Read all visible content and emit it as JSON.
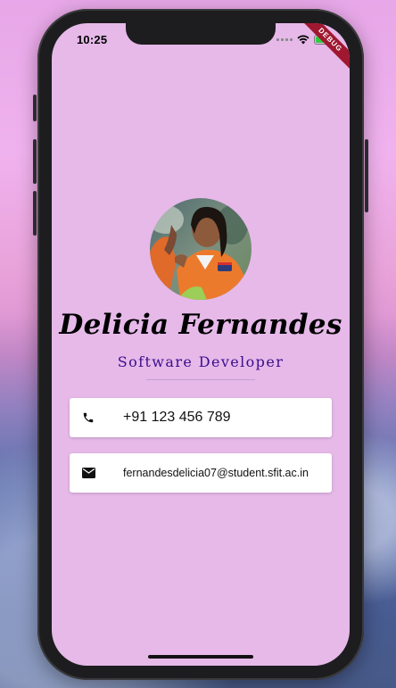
{
  "status_bar": {
    "time": "10:25",
    "debug_label": "DEBUG"
  },
  "profile": {
    "name": "Delicia Fernandes",
    "title": "Software Developer",
    "avatar_icon": "profile-photo"
  },
  "contacts": [
    {
      "icon": "phone-icon",
      "value": "+91 123 456 789"
    },
    {
      "icon": "email-icon",
      "value": "fernandesdelicia07@student.sfit.ac.in"
    }
  ],
  "colors": {
    "background": "#e6b9e9",
    "title_color": "#3a0d8c",
    "card": "#ffffff",
    "debug_banner": "#a01830"
  }
}
